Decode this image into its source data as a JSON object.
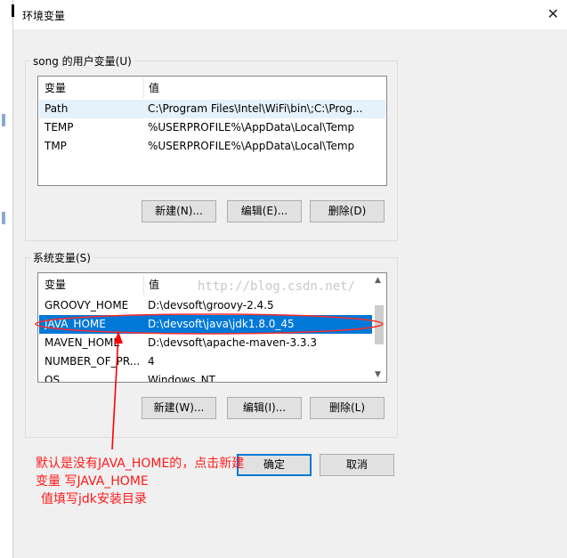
{
  "window": {
    "title": "环境变量",
    "close_glyph": "✕"
  },
  "user_section": {
    "label": "song 的用户变量(U)",
    "headers": [
      "变量",
      "值"
    ],
    "rows": [
      {
        "name": "Path",
        "value": "C:\\Program Files\\Intel\\WiFi\\bin\\;C:\\Prog..."
      },
      {
        "name": "TEMP",
        "value": "%USERPROFILE%\\AppData\\Local\\Temp"
      },
      {
        "name": "TMP",
        "value": "%USERPROFILE%\\AppData\\Local\\Temp"
      }
    ],
    "buttons": {
      "new": "新建(N)...",
      "edit": "编辑(E)...",
      "delete": "删除(D)"
    }
  },
  "system_section": {
    "label": "系统变量(S)",
    "headers": [
      "变量",
      "值"
    ],
    "rows": [
      {
        "name": "GROOVY_HOME",
        "value": "D:\\devsoft\\groovy-2.4.5"
      },
      {
        "name": "JAVA_HOME",
        "value": "D:\\devsoft\\java\\jdk1.8.0_45"
      },
      {
        "name": "MAVEN_HOME",
        "value": "D:\\devsoft\\apache-maven-3.3.3"
      },
      {
        "name": "NUMBER_OF_PR...",
        "value": "4"
      },
      {
        "name": "OS",
        "value": "Windows_NT"
      }
    ],
    "selected_index": 1,
    "buttons": {
      "new": "新建(W)...",
      "edit": "编辑(I)...",
      "delete": "删除(L)"
    }
  },
  "footer": {
    "ok": "确定",
    "cancel": "取消"
  },
  "watermark": "http://blog.csdn.net/",
  "annotation": {
    "line1": "默认是没有JAVA_HOME的，点击新建",
    "line2": "变量 写JAVA_HOME",
    "line3": "值填写jdk安装目录",
    "color": "#ff1a1a"
  },
  "colors": {
    "selection": "#0078d7",
    "dialog_bg": "#f0f0f0"
  }
}
